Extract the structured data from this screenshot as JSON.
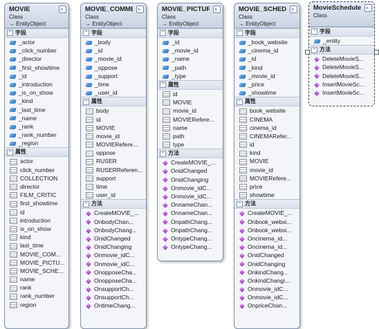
{
  "classes": [
    {
      "name": "MOVIE",
      "kind": "Class",
      "base": "EntityObject",
      "sections": [
        {
          "label": "字段",
          "icon": "field",
          "items": [
            "_actor",
            "_click_number",
            "_director",
            "_first_showtime",
            "_id",
            "_introduction",
            "_is_on_show",
            "_kind",
            "_last_time",
            "_name",
            "_rank",
            "_rank_number",
            "_region"
          ]
        },
        {
          "label": "属性",
          "icon": "prop",
          "items": [
            "actor",
            "click_number",
            "COLLECTION",
            "director",
            "FILM_CRITIC",
            "first_showtime",
            "id",
            "introduction",
            "is_on_show",
            "kind",
            "last_time",
            "MOVIE_COM...",
            "MOVIE_PICTU...",
            "MOVIE_SCHE...",
            "name",
            "rank",
            "rank_number",
            "region"
          ]
        }
      ]
    },
    {
      "name": "MOVIE_COMMENT",
      "kind": "Class",
      "base": "EntityObject",
      "sections": [
        {
          "label": "字段",
          "icon": "field",
          "items": [
            "_body",
            "_id",
            "_movie_id",
            "_oppose",
            "_support",
            "_time",
            "_user_id"
          ]
        },
        {
          "label": "属性",
          "icon": "prop",
          "items": [
            "body",
            "id",
            "MOVIE",
            "movie_id",
            "MOVIERefere...",
            "oppose",
            "RUSER",
            "RUSERReferen...",
            "support",
            "time",
            "user_id"
          ]
        },
        {
          "label": "方法",
          "icon": "method",
          "items": [
            "CreateMOVIE_...",
            "OnbodyChan...",
            "OnbodyChang...",
            "OnidChanged",
            "OnidChanging",
            "Onmovie_idC...",
            "Onmovie_idC...",
            "OnopposeCha...",
            "OnopposeCha...",
            "OnsupportCh...",
            "OnsupportCh...",
            "OntimeChang..."
          ]
        }
      ]
    },
    {
      "name": "MOVIE_PICTURE",
      "kind": "Class",
      "base": "EntityObject",
      "sections": [
        {
          "label": "字段",
          "icon": "field",
          "items": [
            "_id",
            "_movie_id",
            "_name",
            "_path",
            "_type"
          ]
        },
        {
          "label": "属性",
          "icon": "prop",
          "items": [
            "id",
            "MOVIE",
            "movie_id",
            "MOVIERefere...",
            "name",
            "path",
            "type"
          ]
        },
        {
          "label": "方法",
          "icon": "method",
          "items": [
            "CreateMOVIE_...",
            "OnidChanged",
            "OnidChanging",
            "Onmovie_idC...",
            "Onmovie_idC...",
            "OnnameChan...",
            "OnnameChan...",
            "OnpathChang...",
            "OnpathChang...",
            "OntypeChang...",
            "OntypeChang..."
          ]
        }
      ]
    },
    {
      "name": "MOVIE_SCHEDULE",
      "kind": "Class",
      "base": "EntityObject",
      "sections": [
        {
          "label": "字段",
          "icon": "field",
          "items": [
            "_book_website",
            "_cinema_id",
            "_id",
            "_kind",
            "_movie_id",
            "_price",
            "_showtime"
          ]
        },
        {
          "label": "属性",
          "icon": "prop",
          "items": [
            "book_website",
            "CINEMA",
            "cinema_id",
            "CINEMARefer...",
            "id",
            "kind",
            "MOVIE",
            "movie_id",
            "MOVIERefere...",
            "price",
            "showtime"
          ]
        },
        {
          "label": "方法",
          "icon": "method",
          "items": [
            "CreateMOVIE_...",
            "Onbook_websi...",
            "Onbook_websi...",
            "Oncinema_id...",
            "Oncinema_id...",
            "OnidChanged",
            "OnidChanging",
            "OnkindChang...",
            "OnkindChangi...",
            "Onmovie_idC...",
            "Onmovie_idC...",
            "OnpriceChan..."
          ]
        }
      ]
    },
    {
      "name": "MovieSchedule",
      "kind": "Class",
      "base": "",
      "sections": [
        {
          "label": "字段",
          "icon": "field",
          "items": [
            "_entity"
          ]
        },
        {
          "label": "方法",
          "icon": "method",
          "items": [
            "DeleteMovieS...",
            "DeleteMovieS...",
            "DeleteMovieS...",
            "InsertMovieSc...",
            "InsertMovieSc..."
          ]
        }
      ]
    }
  ]
}
